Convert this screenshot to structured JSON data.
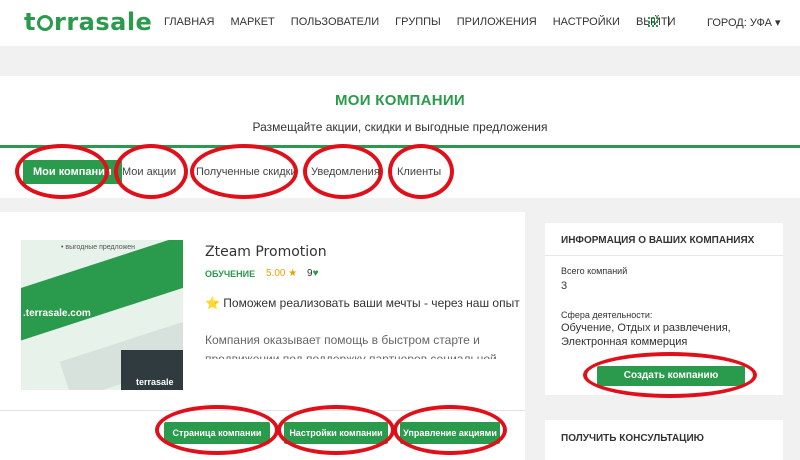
{
  "header": {
    "logo_pre": "t",
    "logo_post": "rrasale",
    "nav": [
      "ГЛАВНАЯ",
      "МАРКЕТ",
      "ПОЛЬЗОВАТЕЛИ",
      "ГРУППЫ",
      "ПРИЛОЖЕНИЯ",
      "НАСТРОЙКИ",
      "ВЫЙТИ"
    ],
    "separator": "|",
    "city": "ГОРОД: УФА ▾"
  },
  "banner": {
    "title": "МОИ КОМПАНИИ",
    "subtitle": "Размещайте акции, скидки и выгодные предложения"
  },
  "tabs": [
    "Мои компании",
    "Мои акции",
    "Полученные скидки",
    "Уведомления",
    "Клиенты"
  ],
  "company": {
    "image_caption_top": "• выгодные предложен",
    "image_url": ".terrasale.com",
    "image_logo": "terrasale",
    "name": "Zteam Promotion",
    "category": "ОБУЧЕНИЕ",
    "rating": "5.00 ★",
    "likes": "9",
    "slogan_star": "⭐",
    "slogan": "Поможем реализовать ваши мечты - через наш опыт",
    "description": "Компания оказывает помощь в быстром старте и продвижении под поддержку партнеров социальной сети",
    "buttons": [
      "Страница компании",
      "Настройки компании",
      "Управление акциями"
    ]
  },
  "sidebar": {
    "title": "ИНФОРМАЦИЯ О ВАШИХ КОМПАНИЯХ",
    "total_label": "Всего компаний",
    "total_value": "3",
    "sphere_label": "Сфера деятельности:",
    "sphere_value": "Обучение, Отдых и развлечения, Электронная коммерция",
    "create_button": "Создать компанию",
    "consult_title": "ПОЛУЧИТЬ КОНСУЛЬТАЦИЮ"
  },
  "colors": {
    "brand_green": "#2a9a4c",
    "annotation_red": "#e0101a",
    "rating_orange": "#e8a200"
  }
}
